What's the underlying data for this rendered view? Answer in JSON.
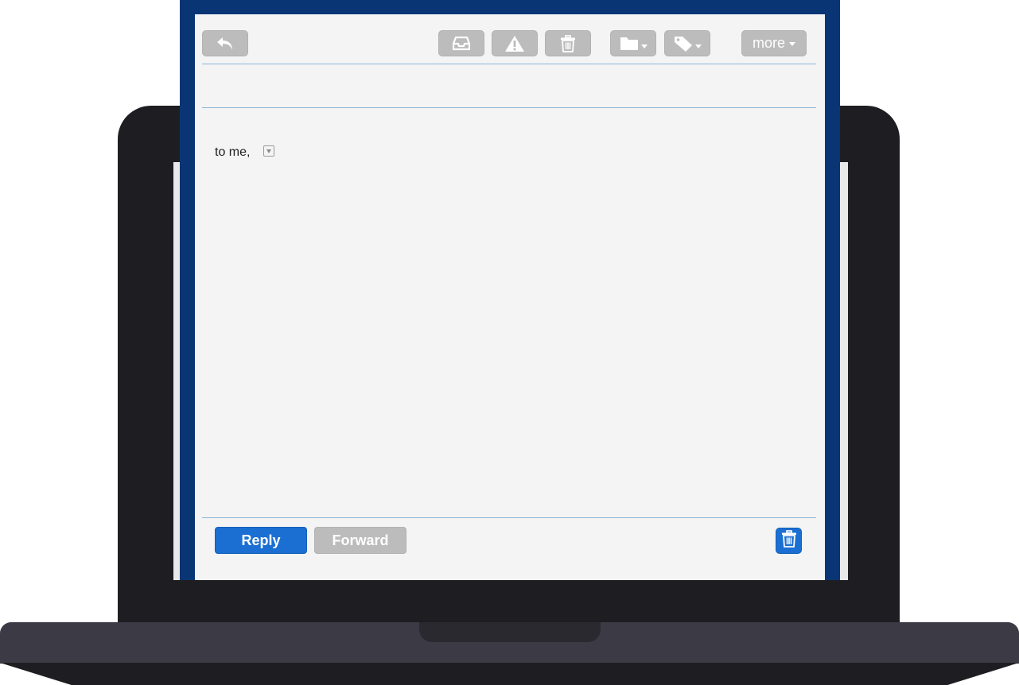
{
  "toolbar": {
    "back_icon": "reply-arrow-icon",
    "archive_icon": "inbox-tray-icon",
    "spam_icon": "warning-triangle-icon",
    "delete_icon": "trash-icon",
    "move_icon": "folder-icon",
    "label_icon": "tag-icon",
    "more_label": "more"
  },
  "message": {
    "recipient_text": "to me,"
  },
  "actions": {
    "reply_label": "Reply",
    "forward_label": "Forward",
    "delete_icon": "trash-icon"
  },
  "colors": {
    "frame": "#0a3575",
    "primary": "#1b6fd2",
    "button_gray": "#bcbcbc",
    "panel_bg": "#f4f4f4",
    "divider": "#8db6d3"
  }
}
